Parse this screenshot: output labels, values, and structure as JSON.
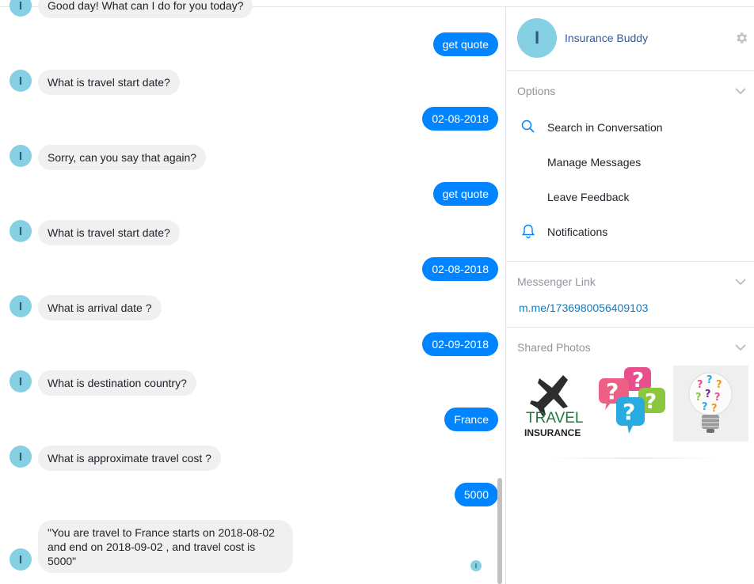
{
  "chat": {
    "avatar_initial": "I",
    "messages": [
      {
        "from": "bot",
        "text": "Good day! What can I do for you today?"
      },
      {
        "from": "user",
        "text": "get quote"
      },
      {
        "from": "bot",
        "text": "What is travel start date?"
      },
      {
        "from": "user",
        "text": "02-08-2018"
      },
      {
        "from": "bot",
        "text": "Sorry, can you say that again?"
      },
      {
        "from": "user",
        "text": "get quote"
      },
      {
        "from": "bot",
        "text": "What is travel start date?"
      },
      {
        "from": "user",
        "text": "02-08-2018"
      },
      {
        "from": "bot",
        "text": "What is arrival date ?"
      },
      {
        "from": "user",
        "text": "02-09-2018"
      },
      {
        "from": "bot",
        "text": "What is destination country?"
      },
      {
        "from": "user",
        "text": "France"
      },
      {
        "from": "bot",
        "text": "What is approximate travel cost ?"
      },
      {
        "from": "user",
        "text": "5000"
      },
      {
        "from": "bot",
        "text": "\"You are travel to France starts on 2018-08-02 and end on 2018-09-02 , and travel cost is 5000\""
      }
    ]
  },
  "sidebar": {
    "profile": {
      "initial": "I",
      "name": "Insurance Buddy",
      "settings_icon": "gear-icon"
    },
    "options": {
      "title": "Options",
      "items": [
        {
          "label": "Search in Conversation",
          "icon": "search-icon"
        },
        {
          "label": "Manage Messages",
          "icon": ""
        },
        {
          "label": "Leave Feedback",
          "icon": ""
        },
        {
          "label": "Notifications",
          "icon": "bell-icon"
        }
      ]
    },
    "messenger_link": {
      "title": "Messenger Link",
      "url": "m.me/1736980056409103"
    },
    "shared_photos": {
      "title": "Shared Photos",
      "travel_word": "TRAVEL",
      "insurance_word": "INSURANCE"
    }
  },
  "colors": {
    "accent": "#0084ff",
    "avatar": "#86d0e3",
    "link": "#0a7cc3"
  }
}
